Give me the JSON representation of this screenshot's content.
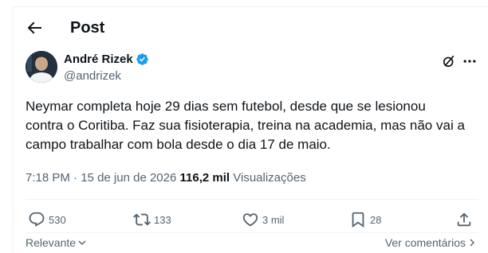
{
  "header": {
    "title": "Post"
  },
  "author": {
    "name": "André Rizek",
    "handle": "@andrizek"
  },
  "post": {
    "text": "Neymar completa hoje 29 dias sem futebol, desde que se lesionou\ncontra o Coritiba. Faz sua fisioterapia, treina na academia, mas não vai a\ncampo trabalhar com bola desde o dia 17 de maio.",
    "time": "7:18 PM",
    "dot": "·",
    "date": "15 de jun de 2026",
    "views_count": "116,2 mil",
    "views_label": "Visualizações"
  },
  "actions": {
    "replies": "530",
    "reposts": "133",
    "likes": "3 mil",
    "bookmarks": "28"
  },
  "footer": {
    "sort_label": "Relevante",
    "view_quotes_label": "Ver comentários"
  },
  "colors": {
    "accent": "#1d9bf0",
    "secondary_text": "#536471",
    "primary_text": "#0f1419"
  },
  "icons": [
    "back-arrow-icon",
    "verified-badge-icon",
    "grok-icon",
    "more-icon",
    "reply-icon",
    "repost-icon",
    "like-icon",
    "bookmark-icon",
    "share-icon",
    "chevron-down-icon",
    "chevron-right-icon"
  ]
}
